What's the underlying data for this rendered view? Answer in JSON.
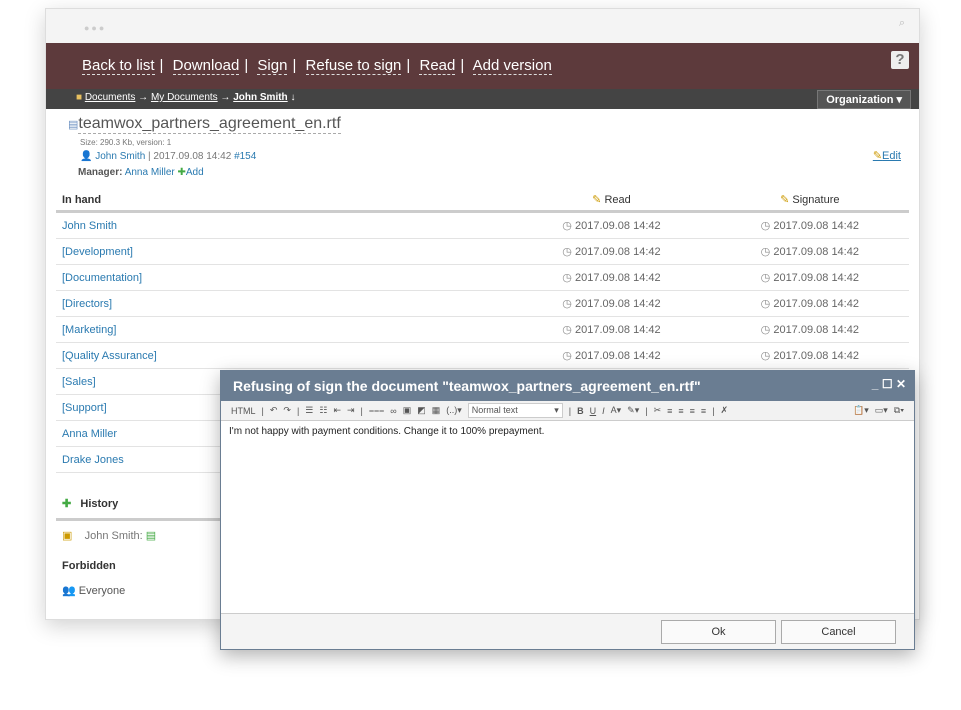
{
  "toolbar": {
    "items": [
      "Back to list",
      "Download",
      "Sign",
      "Refuse to sign",
      "Read",
      "Add version"
    ],
    "help": "?"
  },
  "breadcrumb": {
    "items": [
      "Documents",
      "My Documents",
      "John Smith"
    ],
    "organization": "Organization"
  },
  "document": {
    "name": "teamwox_partners_agreement_en.rtf",
    "meta": "Size: 290.3 Kb, version: 1",
    "author": "John Smith",
    "date": "| 2017.09.08 14:42",
    "id": "#154",
    "manager_label": "Manager:",
    "manager": "Anna Miller",
    "add": "Add",
    "edit": "Edit"
  },
  "table": {
    "headers": [
      "In hand",
      "Read",
      "Signature"
    ],
    "rows": [
      {
        "name": "John Smith",
        "read": "2017.09.08 14:42",
        "sign": "2017.09.08 14:42"
      },
      {
        "name": "[Development]",
        "read": "2017.09.08 14:42",
        "sign": "2017.09.08 14:42"
      },
      {
        "name": "[Documentation]",
        "read": "2017.09.08 14:42",
        "sign": "2017.09.08 14:42"
      },
      {
        "name": "[Directors]",
        "read": "2017.09.08 14:42",
        "sign": "2017.09.08 14:42"
      },
      {
        "name": "[Marketing]",
        "read": "2017.09.08 14:42",
        "sign": "2017.09.08 14:42"
      },
      {
        "name": "[Quality Assurance]",
        "read": "2017.09.08 14:42",
        "sign": "2017.09.08 14:42"
      },
      {
        "name": "[Sales]",
        "read": "",
        "sign": ""
      },
      {
        "name": "[Support]",
        "read": "",
        "sign": ""
      },
      {
        "name": "Anna Miller",
        "read": "",
        "sign": ""
      },
      {
        "name": "Drake Jones",
        "read": "",
        "sign": ""
      }
    ]
  },
  "history": {
    "title": "History",
    "entry": "John Smith:"
  },
  "forbidden": {
    "title": "Forbidden",
    "entry": "Everyone"
  },
  "dialog": {
    "title": "Refusing of sign the document \"teamwox_partners_agreement_en.rtf\"",
    "html": "HTML",
    "format": "Normal text",
    "text": "I'm not happy with payment conditions. Change it to 100% prepayment.",
    "ok": "Ok",
    "cancel": "Cancel"
  }
}
